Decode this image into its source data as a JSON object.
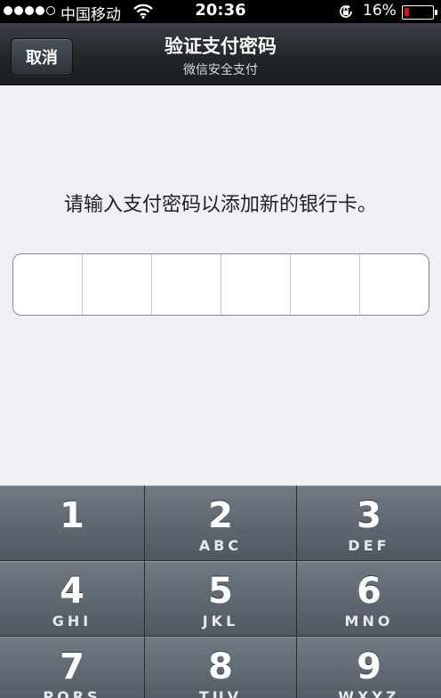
{
  "status_bar": {
    "carrier": "中国移动",
    "time": "20:36",
    "battery_percent": "16%",
    "battery_level": 0.16,
    "battery_color": "#e11111",
    "icons": [
      "signal-dots-icon",
      "wifi-icon",
      "rotation-lock-icon",
      "battery-icon"
    ]
  },
  "nav": {
    "cancel_label": "取消",
    "title": "验证支付密码",
    "subtitle": "微信安全支付"
  },
  "main": {
    "prompt": "请输入支付密码以添加新的银行卡。",
    "pin_length": 6
  },
  "keypad": {
    "keys": [
      {
        "digit": "1",
        "letters": ""
      },
      {
        "digit": "2",
        "letters": "ABC"
      },
      {
        "digit": "3",
        "letters": "DEF"
      },
      {
        "digit": "4",
        "letters": "GHI"
      },
      {
        "digit": "5",
        "letters": "JKL"
      },
      {
        "digit": "6",
        "letters": "MNO"
      },
      {
        "digit": "7",
        "letters": "PQRS"
      },
      {
        "digit": "8",
        "letters": "TUV"
      },
      {
        "digit": "9",
        "letters": "WXYZ"
      }
    ]
  }
}
